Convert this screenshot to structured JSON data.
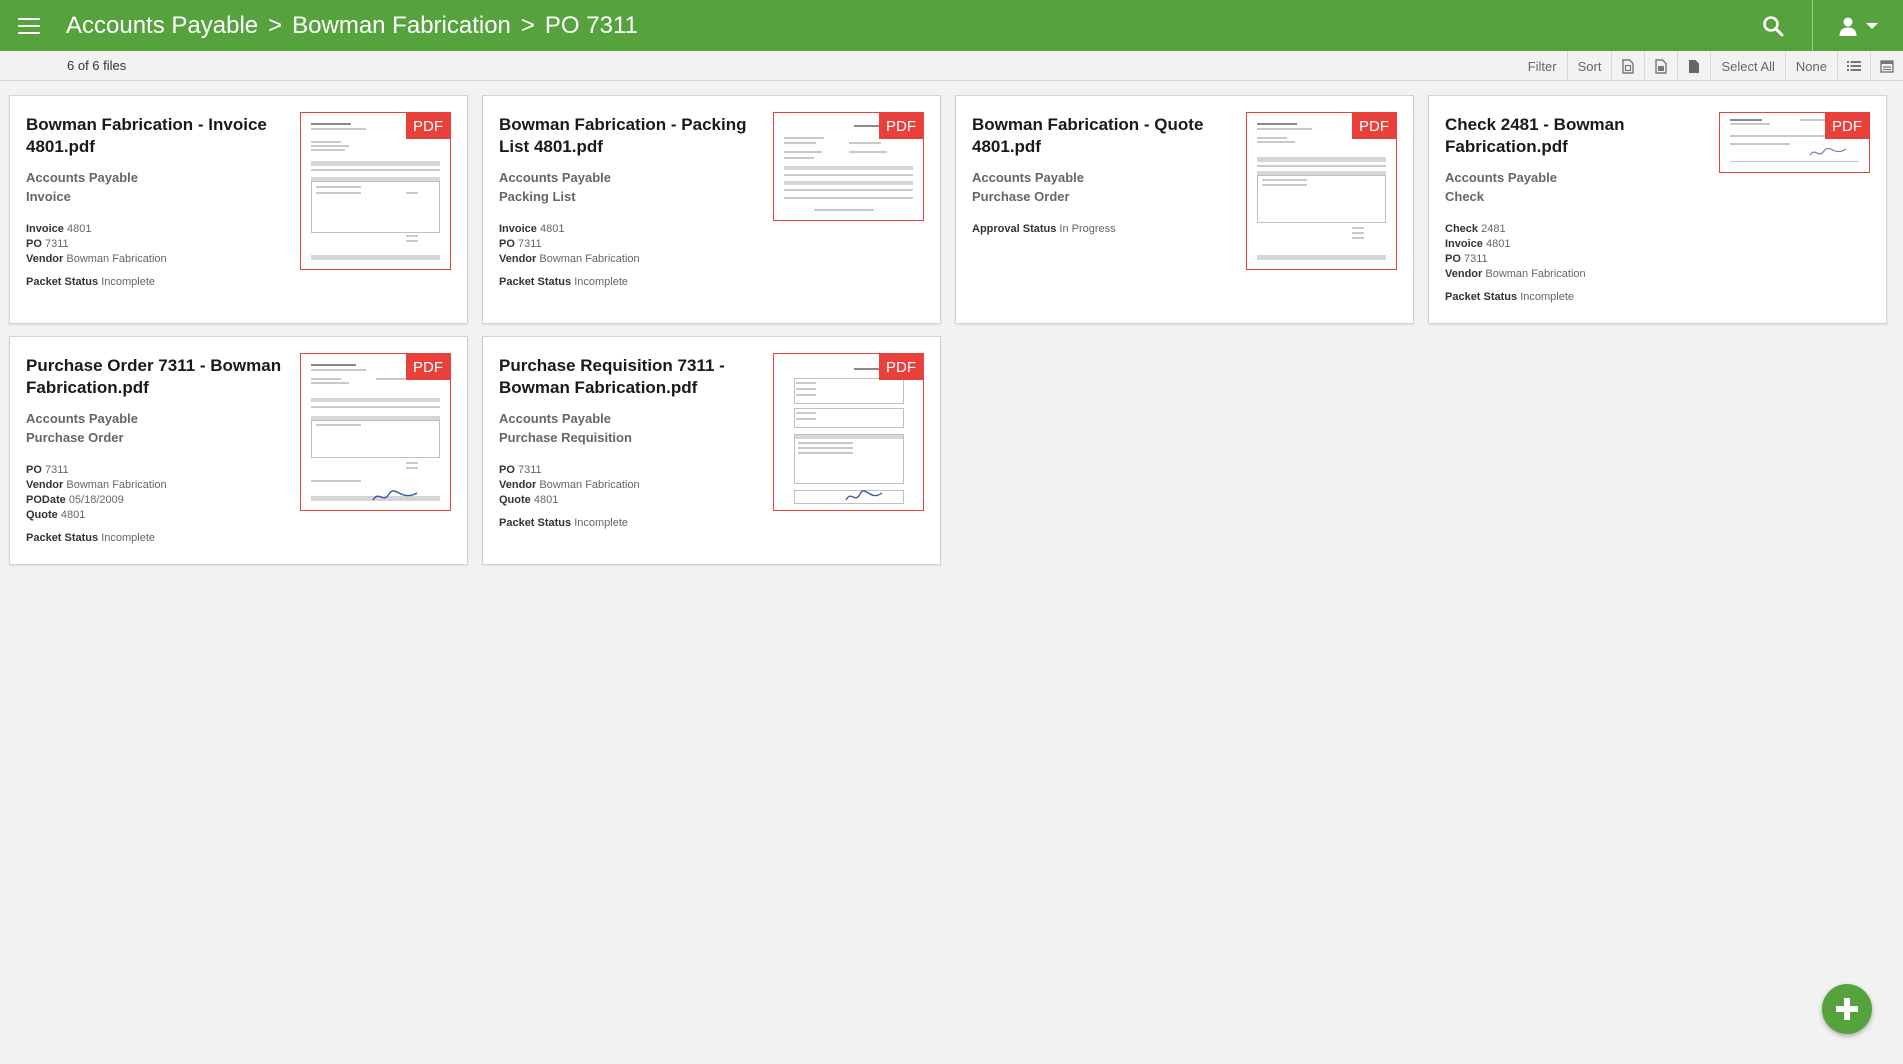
{
  "header": {
    "breadcrumb": [
      "Accounts Payable",
      "Bowman Fabrication",
      "PO 7311"
    ],
    "separator": ">",
    "accent_color": "#56a33e"
  },
  "toolbar": {
    "file_count": "6 of 6 files",
    "filter_label": "Filter",
    "sort_label": "Sort",
    "select_all_label": "Select All",
    "none_label": "None"
  },
  "cards": [
    {
      "title": "Bowman Fabrication - Invoice 4801.pdf",
      "category": "Accounts Payable",
      "doc_type": "Invoice",
      "badge": "PDF",
      "fields": [
        {
          "label": "Invoice",
          "value": "4801"
        },
        {
          "label": "PO",
          "value": "7311"
        },
        {
          "label": "Vendor",
          "value": "Bowman Fabrication"
        }
      ],
      "status": {
        "label": "Packet Status",
        "value": "Incomplete"
      }
    },
    {
      "title": "Bowman Fabrication - Packing List 4801.pdf",
      "category": "Accounts Payable",
      "doc_type": "Packing List",
      "badge": "PDF",
      "fields": [
        {
          "label": "Invoice",
          "value": "4801"
        },
        {
          "label": "PO",
          "value": "7311"
        },
        {
          "label": "Vendor",
          "value": "Bowman Fabrication"
        }
      ],
      "status": {
        "label": "Packet Status",
        "value": "Incomplete"
      }
    },
    {
      "title": "Bowman Fabrication - Quote 4801.pdf",
      "category": "Accounts Payable",
      "doc_type": "Purchase Order",
      "badge": "PDF",
      "fields": [],
      "status": {
        "label": "Approval Status",
        "value": "In Progress"
      }
    },
    {
      "title": "Check 2481 - Bowman Fabrication.pdf",
      "category": "Accounts Payable",
      "doc_type": "Check",
      "badge": "PDF",
      "fields": [
        {
          "label": "Check",
          "value": "2481"
        },
        {
          "label": "Invoice",
          "value": "4801"
        },
        {
          "label": "PO",
          "value": "7311"
        },
        {
          "label": "Vendor",
          "value": "Bowman Fabrication"
        }
      ],
      "status": {
        "label": "Packet Status",
        "value": "Incomplete"
      }
    },
    {
      "title": "Purchase Order 7311 - Bowman Fabrication.pdf",
      "category": "Accounts Payable",
      "doc_type": "Purchase Order",
      "badge": "PDF",
      "fields": [
        {
          "label": "PO",
          "value": "7311"
        },
        {
          "label": "Vendor",
          "value": "Bowman Fabrication"
        },
        {
          "label": "PODate",
          "value": "05/18/2009"
        },
        {
          "label": "Quote",
          "value": "4801"
        }
      ],
      "status": {
        "label": "Packet Status",
        "value": "Incomplete"
      }
    },
    {
      "title": "Purchase Requisition 7311 - Bowman Fabrication.pdf",
      "category": "Accounts Payable",
      "doc_type": "Purchase Requisition",
      "badge": "PDF",
      "fields": [
        {
          "label": "PO",
          "value": "7311"
        },
        {
          "label": "Vendor",
          "value": "Bowman Fabrication"
        },
        {
          "label": "Quote",
          "value": "4801"
        }
      ],
      "status": {
        "label": "Packet Status",
        "value": "Incomplete"
      }
    }
  ],
  "icons": {
    "menu": "hamburger-icon",
    "search": "search-icon",
    "user": "user-icon",
    "add": "plus-icon"
  }
}
